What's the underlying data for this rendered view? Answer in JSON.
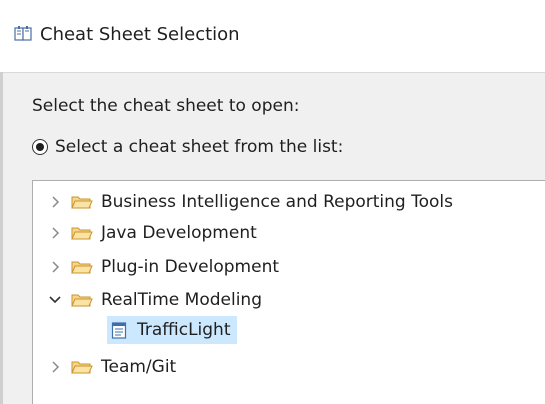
{
  "window": {
    "title": "Cheat Sheet Selection"
  },
  "dialog": {
    "prompt": "Select the cheat sheet to open:",
    "radio_option": "Select a cheat sheet from the list:"
  },
  "tree": {
    "items": [
      {
        "label": "Business Intelligence and Reporting Tools",
        "expanded": false,
        "icon": "folder-icon"
      },
      {
        "label": "Java Development",
        "expanded": false,
        "icon": "folder-icon"
      },
      {
        "label": "Plug-in Development",
        "expanded": false,
        "icon": "folder-icon"
      },
      {
        "label": "RealTime Modeling",
        "expanded": true,
        "icon": "folder-icon",
        "children": [
          {
            "label": "TrafficLight",
            "selected": true,
            "icon": "cheat-sheet-icon"
          }
        ]
      },
      {
        "label": "Team/Git",
        "expanded": false,
        "icon": "folder-icon"
      }
    ]
  },
  "colors": {
    "selection": "#cce8ff",
    "folder_fill": "#f6d58a",
    "folder_stroke": "#c9952c"
  }
}
